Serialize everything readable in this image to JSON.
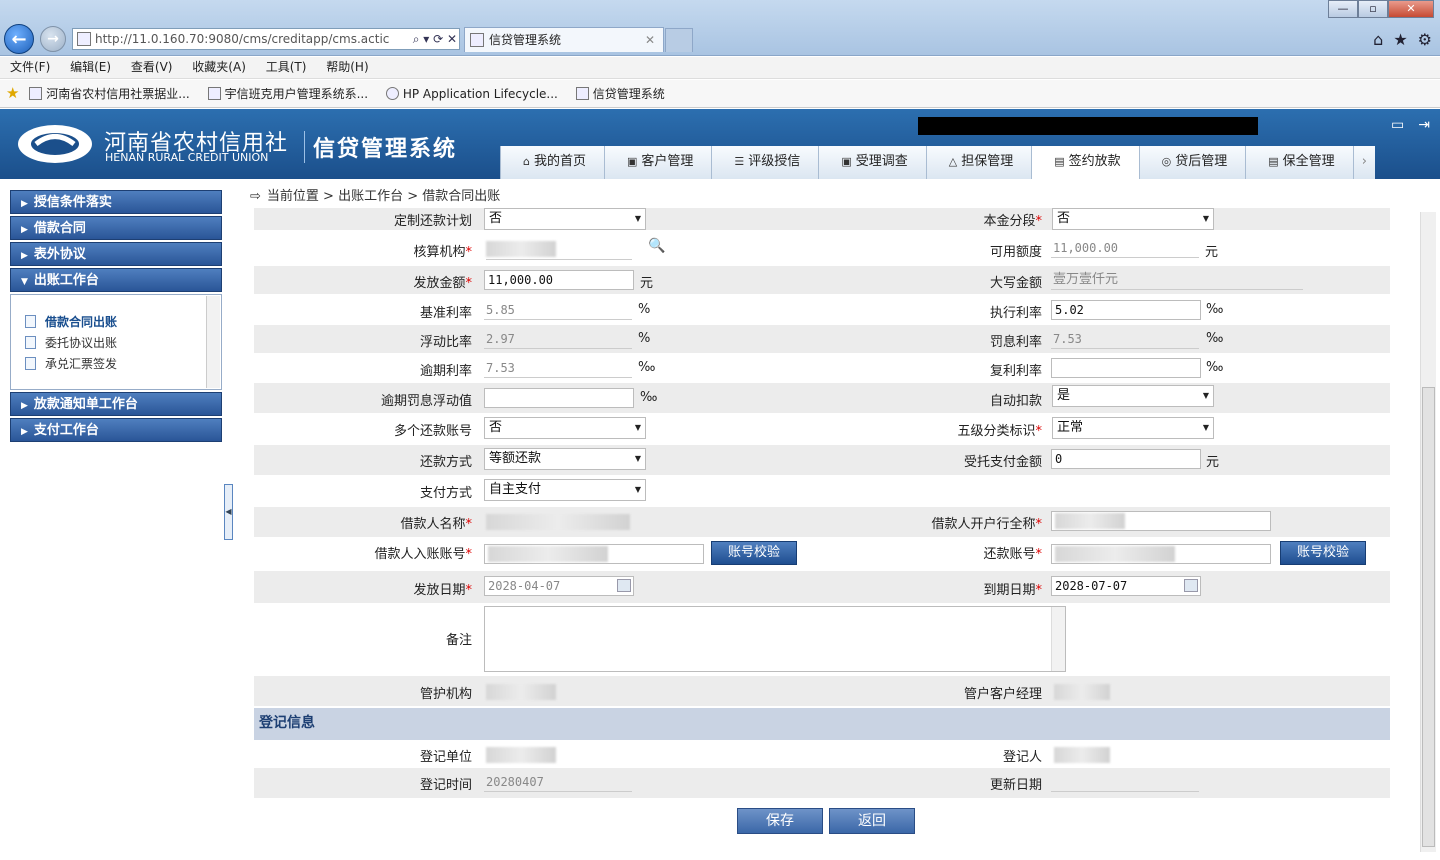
{
  "browser": {
    "url": "http://11.0.160.70:9080/cms/creditapp/cms.actic",
    "tab_title": "信贷管理系统",
    "menu": [
      "文件(F)",
      "编辑(E)",
      "查看(V)",
      "收藏夹(A)",
      "工具(T)",
      "帮助(H)"
    ],
    "favorites": [
      "河南省农村信用社票据业...",
      "宇信班克用户管理系统系...",
      "HP Application Lifecycle...",
      "信贷管理系统"
    ],
    "window_buttons": [
      "—",
      "▫",
      "✕"
    ]
  },
  "header": {
    "org_cn": "河南省农村信用社",
    "org_en": "HENAN RURAL CREDIT UNION",
    "system_name": "信贷管理系统",
    "nav": [
      {
        "label": "我的首页",
        "icon": "home-icon"
      },
      {
        "label": "客户管理",
        "icon": "customer-icon"
      },
      {
        "label": "评级授信",
        "icon": "rating-icon"
      },
      {
        "label": "受理调查",
        "icon": "survey-icon"
      },
      {
        "label": "担保管理",
        "icon": "guarantee-icon"
      },
      {
        "label": "签约放款",
        "icon": "contract-icon"
      },
      {
        "label": "贷后管理",
        "icon": "postloan-icon"
      },
      {
        "label": "保全管理",
        "icon": "preserve-icon"
      }
    ],
    "active_nav": "签约放款"
  },
  "sidebar": {
    "groups": [
      "授信条件落实",
      "借款合同",
      "表外协议",
      "出账工作台",
      "放款通知单工作台",
      "支付工作台"
    ],
    "sub_items": [
      "借款合同出账",
      "委托协议出账",
      "承兑汇票签发"
    ],
    "current_sub": "借款合同出账"
  },
  "breadcrumb": "当前位置 > 出账工作台 > 借款合同出账",
  "form": {
    "r1": {
      "l_label": "定制还款计划",
      "l_value": "否",
      "r_label": "本金分段",
      "r_value": "否"
    },
    "r2": {
      "l_label": "核算机构",
      "r_label": "可用额度",
      "r_value": "11,000.00",
      "r_unit": "元"
    },
    "r3": {
      "l_label": "发放金额",
      "l_value": "11,000.00",
      "l_unit": "元",
      "r_label": "大写金额",
      "r_value": "壹万壹仟元"
    },
    "r4": {
      "l_label": "基准利率",
      "l_value": "5.85",
      "l_unit": "%",
      "r_label": "执行利率",
      "r_value": "5.02",
      "r_unit": "‰"
    },
    "r5": {
      "l_label": "浮动比率",
      "l_value": "2.97",
      "l_unit": "%",
      "r_label": "罚息利率",
      "r_value": "7.53",
      "r_unit": "‰"
    },
    "r6": {
      "l_label": "逾期利率",
      "l_value": "7.53",
      "l_unit": "‰",
      "r_label": "复利利率",
      "r_value": "",
      "r_unit": "‰"
    },
    "r7": {
      "l_label": "逾期罚息浮动值",
      "l_value": "",
      "l_unit": "‰",
      "r_label": "自动扣款",
      "r_value": "是"
    },
    "r8": {
      "l_label": "多个还款账号",
      "l_value": "否",
      "r_label": "五级分类标识",
      "r_value": "正常"
    },
    "r9": {
      "l_label": "还款方式",
      "l_value": "等额还款",
      "r_label": "受托支付金额",
      "r_value": "0",
      "r_unit": "元"
    },
    "r10": {
      "l_label": "支付方式",
      "l_value": "自主支付"
    },
    "r11": {
      "l_label": "借款人名称",
      "r_label": "借款人开户行全称"
    },
    "r12": {
      "l_label": "借款人入账账号",
      "l_btn": "账号校验",
      "r_label": "还款账号",
      "r_btn": "账号校验"
    },
    "r13": {
      "l_label": "发放日期",
      "l_value": "2028-04-07",
      "r_label": "到期日期",
      "r_value": "2028-07-07"
    },
    "r14": {
      "l_label": "备注"
    },
    "r15": {
      "l_label": "管护机构",
      "r_label": "管户客户经理"
    },
    "section_title": "登记信息",
    "r16": {
      "l_label": "登记单位",
      "r_label": "登记人"
    },
    "r17": {
      "l_label": "登记时间",
      "l_value": "20280407",
      "r_label": "更新日期"
    }
  },
  "actions": {
    "save": "保存",
    "back": "返回"
  }
}
